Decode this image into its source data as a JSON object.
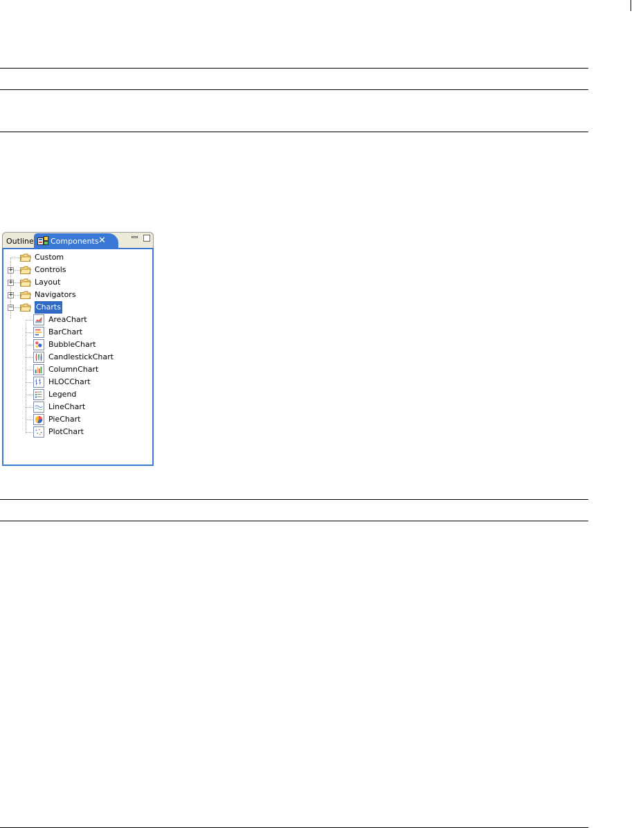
{
  "panel": {
    "tabs": [
      {
        "label": "Outline",
        "active": false
      },
      {
        "label": "Components",
        "active": true
      }
    ],
    "close_glyph": "✕",
    "tree": {
      "folders": [
        {
          "label": "Custom",
          "expandable": false
        },
        {
          "label": "Controls",
          "expandable": true,
          "expanded": false
        },
        {
          "label": "Layout",
          "expandable": true,
          "expanded": false
        },
        {
          "label": "Navigators",
          "expandable": true,
          "expanded": false
        },
        {
          "label": "Charts",
          "expandable": true,
          "expanded": true,
          "selected": true
        }
      ],
      "chart_items": [
        {
          "label": "AreaChart",
          "icon": "area-chart-icon"
        },
        {
          "label": "BarChart",
          "icon": "bar-chart-icon"
        },
        {
          "label": "BubbleChart",
          "icon": "bubble-chart-icon"
        },
        {
          "label": "CandlestickChart",
          "icon": "candlestick-chart-icon"
        },
        {
          "label": "ColumnChart",
          "icon": "column-chart-icon"
        },
        {
          "label": "HLOCChart",
          "icon": "hloc-chart-icon"
        },
        {
          "label": "Legend",
          "icon": "legend-icon"
        },
        {
          "label": "LineChart",
          "icon": "line-chart-icon"
        },
        {
          "label": "PieChart",
          "icon": "pie-chart-icon"
        },
        {
          "label": "PlotChart",
          "icon": "plot-chart-icon"
        }
      ]
    }
  },
  "colors": {
    "accent": "#3a78d6",
    "selection": "#316ac5",
    "tabbar": "#ece9d8"
  }
}
